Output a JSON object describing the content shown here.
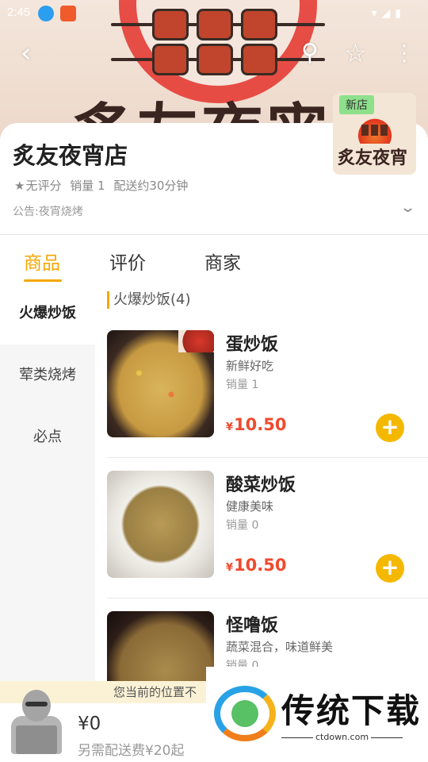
{
  "status_bar": {
    "time": "2:45"
  },
  "banner": {
    "brand_text": "炙友夜宵"
  },
  "shop": {
    "name": "炙友夜宵店",
    "rating_text": "无评分",
    "sales_text": "销量 1",
    "delivery_text": "配送约30分钟",
    "notice": "公告:夜宵烧烤",
    "logo_badge": "新店",
    "logo_text": "炙友夜宵"
  },
  "tabs": [
    {
      "label": "商品",
      "active": true
    },
    {
      "label": "评价",
      "active": false
    },
    {
      "label": "商家",
      "active": false
    }
  ],
  "categories": [
    {
      "label": "火爆炒饭",
      "active": true
    },
    {
      "label": "荤类烧烤",
      "active": false
    },
    {
      "label": "必点",
      "active": false
    }
  ],
  "section": {
    "title": "火爆炒饭(4)"
  },
  "products": [
    {
      "name": "蛋炒饭",
      "desc": "新鲜好吃",
      "sold": "销量 1",
      "currency": "¥",
      "price": "10.50"
    },
    {
      "name": "酸菜炒饭",
      "desc": "健康美味",
      "sold": "销量 0",
      "currency": "¥",
      "price": "10.50"
    },
    {
      "name": "怪噜饭",
      "desc": "蔬菜混合，味道鲜美",
      "sold": "销量 0",
      "currency": "¥",
      "price": ""
    }
  ],
  "cart": {
    "location_tip": "您当前的位置不",
    "total": "¥0",
    "note": "另需配送费¥20起"
  },
  "watermark": {
    "text": "传统下载",
    "url": "ctdown.com"
  },
  "colors": {
    "accent": "#f5a700",
    "price": "#f04a2e",
    "add_button": "#f5b800"
  },
  "icons": [
    "back-arrow-icon",
    "search-icon",
    "star-icon",
    "more-vertical-icon",
    "chevron-down-icon",
    "plus-icon",
    "download-icon"
  ]
}
